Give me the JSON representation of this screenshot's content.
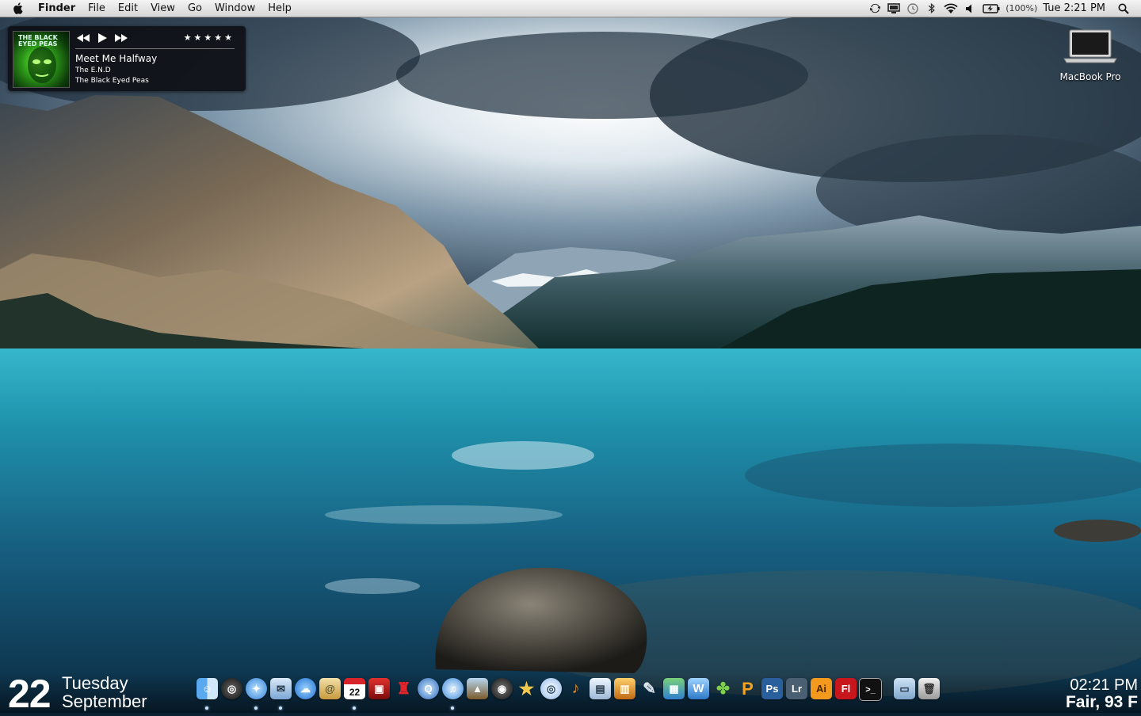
{
  "menubar": {
    "app_name": "Finder",
    "menus": [
      "File",
      "Edit",
      "View",
      "Go",
      "Window",
      "Help"
    ],
    "battery_text": "(100%)",
    "clock_text": "Tue 2:21 PM"
  },
  "itunes": {
    "rating": "★★★★★",
    "title": "Meet Me Halfway",
    "album": "The E.N.D",
    "artist": "The Black Eyed Peas",
    "album_art_text": "THE BLACK EYED PEAS"
  },
  "desktop": {
    "drive_label": "MacBook Pro"
  },
  "date_widget": {
    "day": "22",
    "weekday": "Tuesday",
    "month": "September"
  },
  "clock_widget": {
    "time": "02:21 PM",
    "weather": "Fair, 93 F"
  },
  "dock": {
    "photoshop_label": "Ps",
    "lightroom_label": "Lr",
    "illustrator_label": "Ai",
    "flash_label": "Fl",
    "calendar_day": "22"
  },
  "colors": {
    "menubar_bg": "#e6e6e6",
    "widget_bg": "#0c0e12",
    "water": "#2aa0b8",
    "photoshop": "#2a5f9e",
    "lightroom": "#4b5f73",
    "illustrator": "#f39a1e",
    "flash": "#c8161d"
  }
}
